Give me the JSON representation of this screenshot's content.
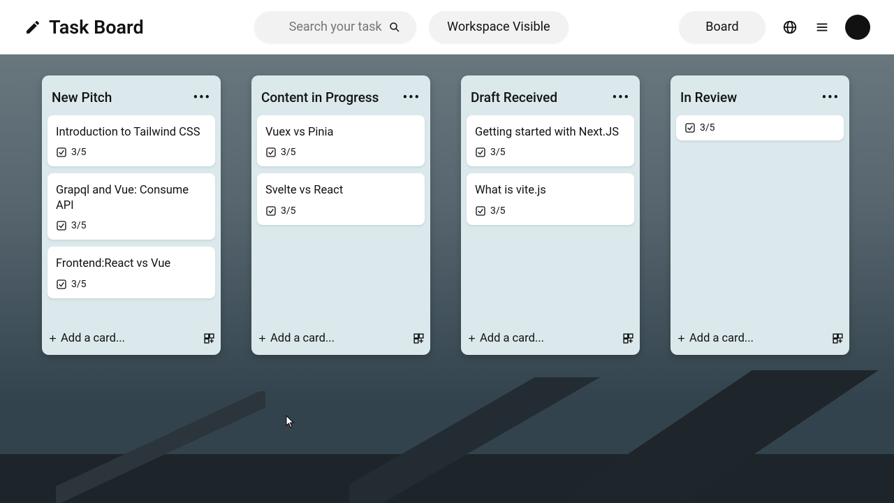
{
  "header": {
    "app_title": "Task Board",
    "search_placeholder": "Search your task",
    "workspace_label": "Workspace Visible",
    "board_label": "Board"
  },
  "add_card_label": "Add a card...",
  "columns": [
    {
      "title": "New Pitch",
      "cards": [
        {
          "title": "Introduction to Tailwind CSS",
          "progress": "3/5"
        },
        {
          "title": "Grapql and Vue: Consume API",
          "progress": "3/5"
        },
        {
          "title": "Frontend:React vs Vue",
          "progress": "3/5"
        }
      ]
    },
    {
      "title": "Content in Progress",
      "cards": [
        {
          "title": "Vuex vs Pinia",
          "progress": "3/5"
        },
        {
          "title": "Svelte vs React",
          "progress": "3/5"
        }
      ]
    },
    {
      "title": "Draft Received",
      "cards": [
        {
          "title": "Getting started with Next.JS",
          "progress": "3/5"
        },
        {
          "title": "What is vite.js",
          "progress": "3/5"
        }
      ]
    },
    {
      "title": "In Review",
      "cards": [
        {
          "title": "",
          "progress": "3/5"
        }
      ]
    }
  ]
}
